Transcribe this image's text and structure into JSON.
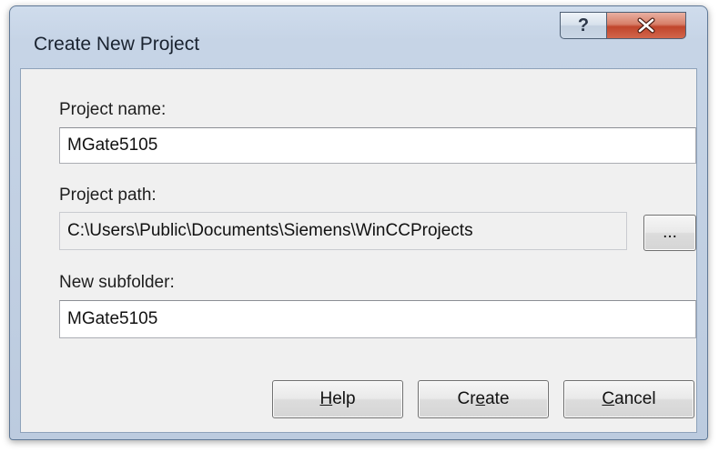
{
  "window": {
    "title": "Create New Project",
    "help_glyph": "?",
    "close_icon": "close-icon"
  },
  "form": {
    "project_name_label": "Project name:",
    "project_name_value": "MGate5105",
    "project_path_label": "Project path:",
    "project_path_value": "C:\\Users\\Public\\Documents\\Siemens\\WinCCProjects",
    "browse_label": "...",
    "subfolder_label": "New subfolder:",
    "subfolder_value": "MGate5105"
  },
  "buttons": {
    "help": {
      "pre": "",
      "key": "H",
      "post": "elp"
    },
    "create": {
      "pre": "Cr",
      "key": "e",
      "post": "ate"
    },
    "cancel": {
      "pre": "",
      "key": "C",
      "post": "ancel"
    }
  },
  "colors": {
    "frame": "#bccbdf",
    "close": "#c0452c",
    "client": "#f0f0f0"
  }
}
